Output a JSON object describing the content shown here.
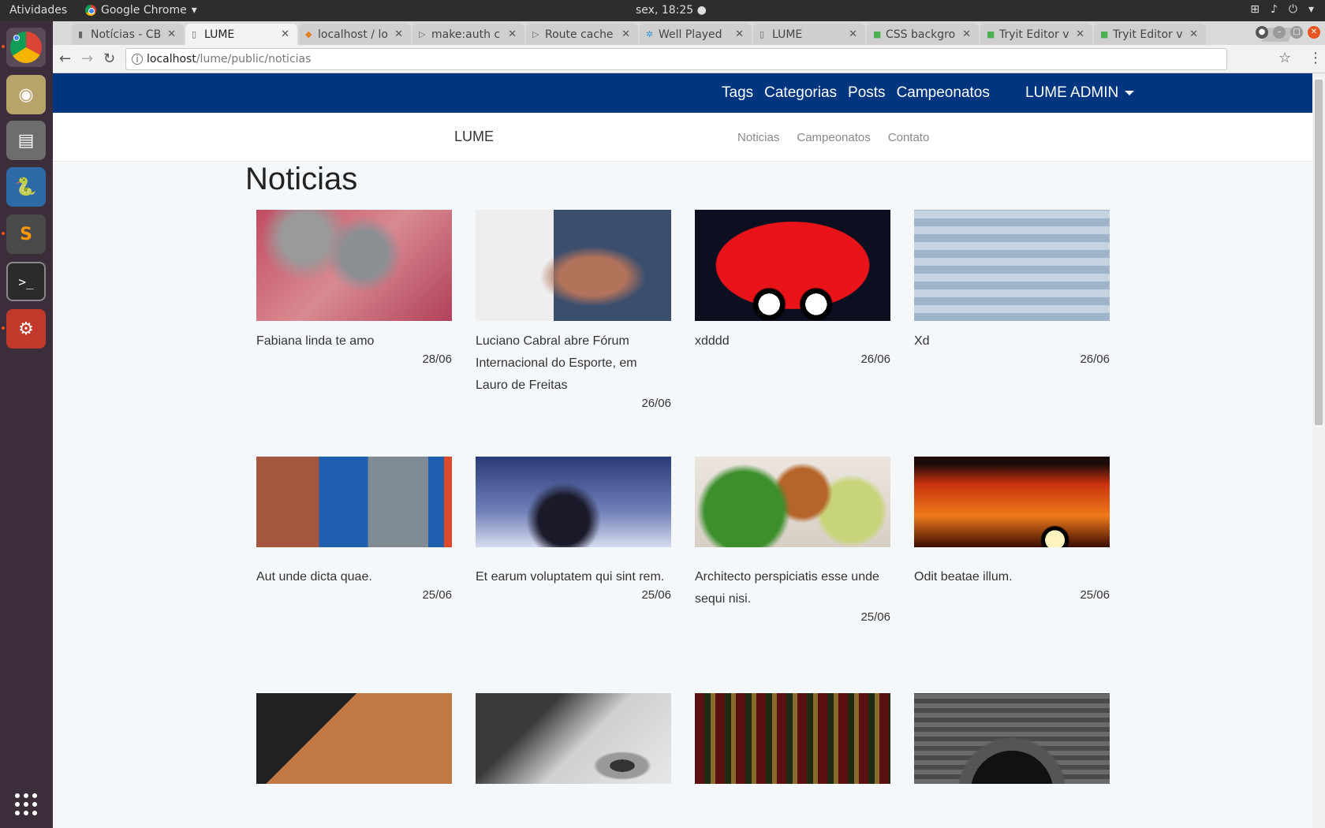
{
  "system": {
    "activities": "Atividades",
    "app_name": "Google Chrome",
    "clock": "sex, 18:25 ●"
  },
  "browser": {
    "tabs": [
      {
        "label": "Notícias - CB",
        "favicon": "page-icon"
      },
      {
        "label": "LUME",
        "favicon": "page-icon"
      },
      {
        "label": "localhost / lo",
        "favicon": "phpmyadmin-icon"
      },
      {
        "label": "make:auth c",
        "favicon": "laravel-icon"
      },
      {
        "label": "Route cache",
        "favicon": "laravel-icon"
      },
      {
        "label": "Well Played",
        "favicon": "puzzle-icon"
      },
      {
        "label": "LUME",
        "favicon": "page-icon"
      },
      {
        "label": "CSS backgro",
        "favicon": "w3-icon"
      },
      {
        "label": "Tryit Editor v",
        "favicon": "w3-icon"
      },
      {
        "label": "Tryit Editor v",
        "favicon": "w3-icon"
      }
    ],
    "url_host": "localhost",
    "url_path": "/lume/public/noticias"
  },
  "admin_nav": {
    "links": [
      "Tags",
      "Categorias",
      "Posts",
      "Campeonatos"
    ],
    "user_menu": "LUME ADMIN"
  },
  "site_nav": {
    "brand": "LUME",
    "links": [
      "Noticias",
      "Campeonatos",
      "Contato"
    ]
  },
  "page": {
    "title": "Noticias",
    "cards": [
      {
        "title": "Fabiana linda te amo",
        "date": "28/06",
        "image": "kittens"
      },
      {
        "title": "Luciano Cabral abre Fórum Internacional do Esporte, em Lauro de Freitas",
        "date": "26/06",
        "image": "speaker"
      },
      {
        "title": "xdddd",
        "date": "26/06",
        "image": "red-bird"
      },
      {
        "title": "Xd",
        "date": "26/06",
        "image": "game-screen"
      },
      {
        "title": "Aut unde dicta quae.",
        "date": "25/06",
        "image": "street-wall"
      },
      {
        "title": "Et earum voluptatem qui sint rem.",
        "date": "25/06",
        "image": "bar-man"
      },
      {
        "title": "Architecto perspiciatis esse unde sequi nisi.",
        "date": "25/06",
        "image": "food"
      },
      {
        "title": "Odit beatae illum.",
        "date": "25/06",
        "image": "sunset"
      },
      {
        "title": "",
        "date": "",
        "image": "phone-earbuds"
      },
      {
        "title": "",
        "date": "",
        "image": "eye-bw"
      },
      {
        "title": "",
        "date": "",
        "image": "bottles"
      },
      {
        "title": "",
        "date": "",
        "image": "camera-lens"
      }
    ]
  }
}
